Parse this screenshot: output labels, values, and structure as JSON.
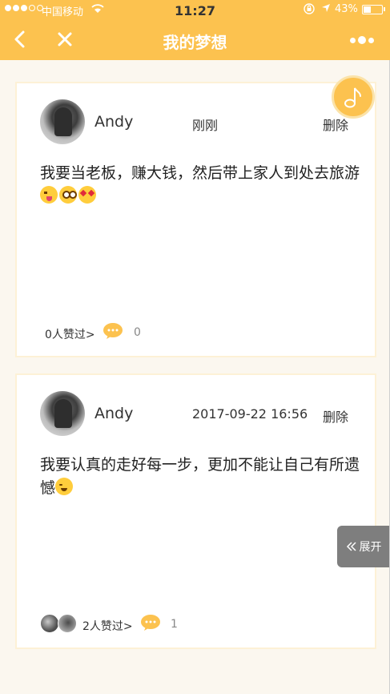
{
  "status_bar": {
    "carrier": "中国移动",
    "time": "11:27",
    "battery": "43%",
    "battery_level": 0.43
  },
  "nav": {
    "title": "我的梦想"
  },
  "posts": [
    {
      "username": "Andy",
      "time": "刚刚",
      "delete_label": "删除",
      "content": "我要当老板，赚大钱，然后带上家人到处去旅游",
      "emojis": [
        "squinting-tongue-emoji",
        "flushed-emoji",
        "heart-eyes-emoji"
      ],
      "likes_label": "0人赞过>",
      "comment_count": "0"
    },
    {
      "username": "Andy",
      "time": "2017-09-22 16:56",
      "delete_label": "删除",
      "content": "我要认真的走好每一步，更加不能让自己有所遗憾",
      "emojis": [
        "smiling-emoji"
      ],
      "likes_label": "2人赞过>",
      "comment_count": "1"
    }
  ],
  "expand_tab": {
    "label": "展开"
  },
  "colors": {
    "brand": "#fcc24f",
    "background": "#fbf7ef",
    "card_border": "#fdf1d6"
  }
}
